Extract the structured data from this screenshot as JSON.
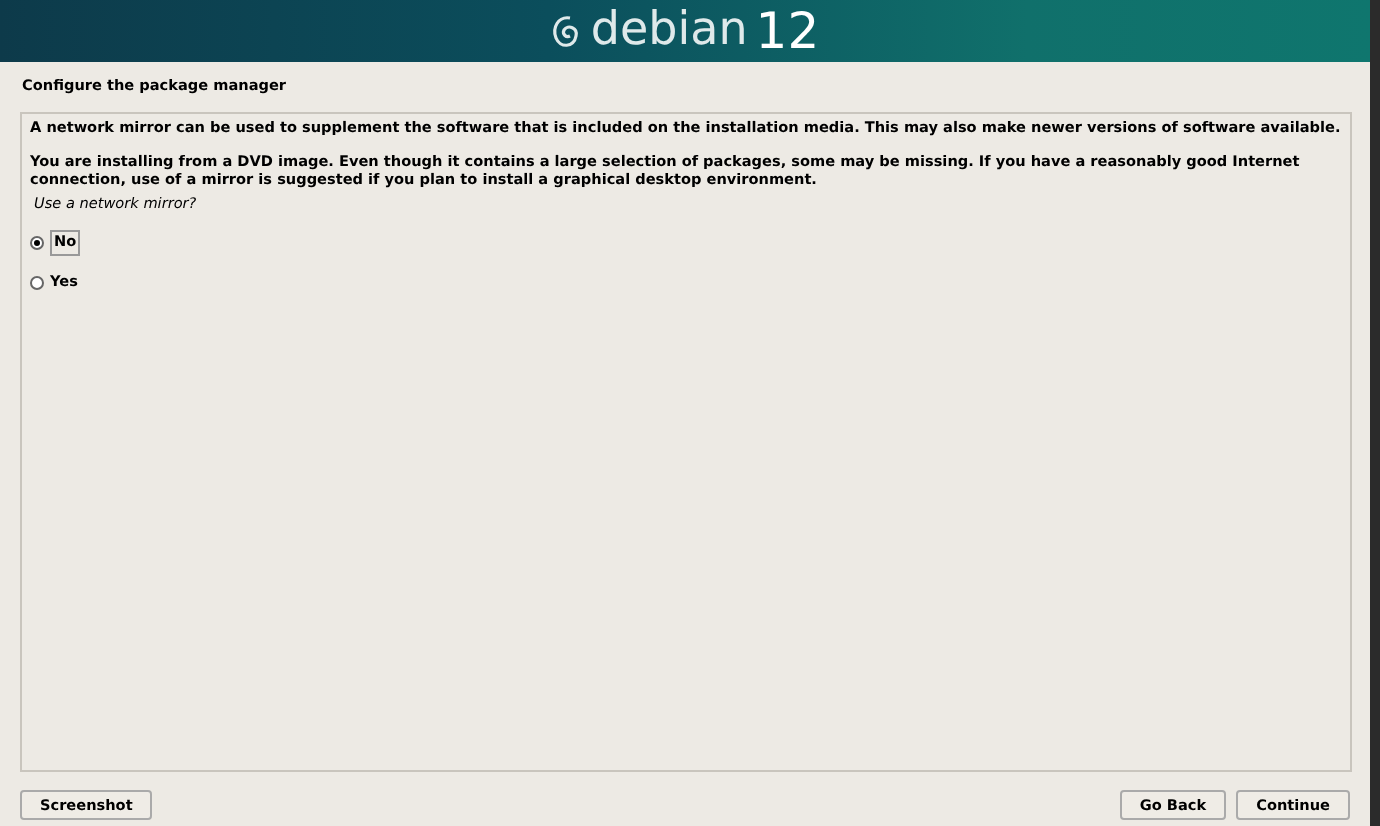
{
  "banner": {
    "logo_text": "debian",
    "version": "12"
  },
  "title": "Configure the package manager",
  "paragraphs": [
    "A network mirror can be used to supplement the software that is included on the installation media. This may also make newer versions of software available.",
    "You are installing from a DVD image. Even though it contains a large selection of packages, some may be missing. If you have a reasonably good Internet connection, use of a mirror is suggested if you plan to install a graphical desktop environment."
  ],
  "question": "Use a network mirror?",
  "options": [
    {
      "label": "No",
      "selected": true
    },
    {
      "label": "Yes",
      "selected": false
    }
  ],
  "buttons": [
    {
      "label": "Screenshot",
      "kind": "left"
    },
    {
      "label": "Go Back",
      "kind": "right"
    },
    {
      "label": "Continue",
      "kind": "right"
    }
  ]
}
